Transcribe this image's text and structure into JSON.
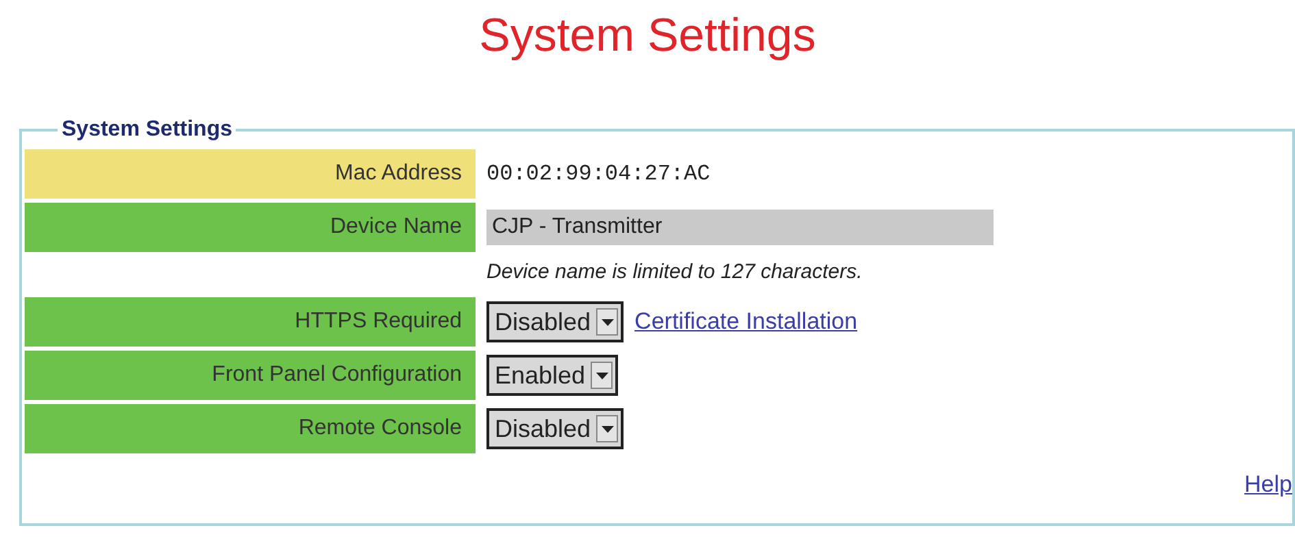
{
  "page_title": "System Settings",
  "panel": {
    "legend": "System Settings",
    "rows": [
      {
        "kind": "readonly",
        "label": "Mac Address",
        "color": "#efe07a",
        "value": "00:02:99:04:27:AC"
      },
      {
        "kind": "input",
        "label": "Device Name",
        "color": "#6cc24a",
        "value": "CJP - Transmitter"
      },
      {
        "kind": "note",
        "text": "Device name is limited to 127 characters."
      },
      {
        "kind": "select",
        "label": "HTTPS Required",
        "color": "#6cc24a",
        "value": "Disabled",
        "link": "Certificate Installation"
      },
      {
        "kind": "select",
        "label": "Front Panel Configuration",
        "color": "#6cc24a",
        "value": "Enabled"
      },
      {
        "kind": "select",
        "label": "Remote Console",
        "color": "#6cc24a",
        "value": "Disabled"
      }
    ],
    "help_link": "Help"
  }
}
